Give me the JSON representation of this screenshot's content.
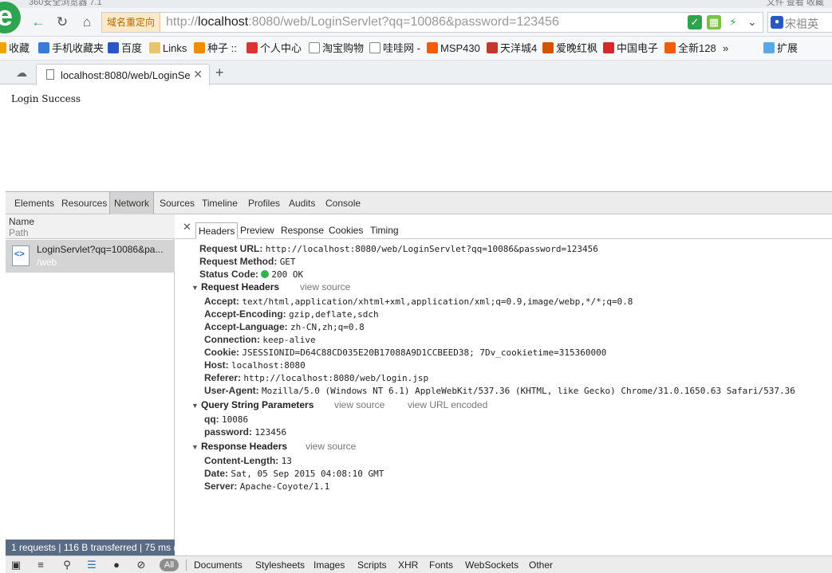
{
  "window": {
    "title": "360安全浏览器 7.1",
    "controls_text": "文件   查看   收藏"
  },
  "navbar": {
    "redirect_label": "域名重定向",
    "url_prefix": "http://",
    "url_host": "localhost",
    "url_rest": ":8080/web/LoginServlet?qq=10086&password=123456",
    "search_placeholder": "宋祖英"
  },
  "bookmarks": [
    {
      "label": "收藏",
      "icon": "star-icon",
      "color": "#f0a400"
    },
    {
      "label": "手机收藏夹",
      "icon": "phone-icon",
      "color": "#3a7bd5"
    },
    {
      "label": "百度",
      "icon": "baidu-icon",
      "color": "#2b57c5"
    },
    {
      "label": "Links",
      "icon": "folder-icon",
      "color": "#e9c46a"
    },
    {
      "label": "种子 ::",
      "icon": "seed-icon",
      "color": "#f08c00"
    },
    {
      "label": "个人中心",
      "icon": "bird-icon",
      "color": "#d33"
    },
    {
      "label": "淘宝购物",
      "icon": "page-icon",
      "color": "#ffffff"
    },
    {
      "label": "哇哇网 -",
      "icon": "page-icon",
      "color": "#ffffff"
    },
    {
      "label": "MSP430",
      "icon": "taobao-icon",
      "color": "#f25c05"
    },
    {
      "label": "天洋城4",
      "icon": "house-icon",
      "color": "#c0392b"
    },
    {
      "label": "爱晚红枫",
      "icon": "leaf-icon",
      "color": "#d35400"
    },
    {
      "label": "中国电子",
      "icon": "site21-icon",
      "color": "#d62828"
    },
    {
      "label": "全新128",
      "icon": "taobao-icon",
      "color": "#f25c05"
    },
    {
      "label": "»",
      "icon": "",
      "color": ""
    },
    {
      "label": "扩展",
      "icon": "extension-icon",
      "color": "#5aa9e6"
    }
  ],
  "tab": {
    "title": "localhost:8080/web/LoginSe"
  },
  "page": {
    "message": "Login Success"
  },
  "devtools": {
    "tabs": [
      "Elements",
      "Resources",
      "Network",
      "Sources",
      "Timeline",
      "Profiles",
      "Audits",
      "Console"
    ],
    "active_tab": "Network",
    "left": {
      "col_name": "Name",
      "col_path": "Path",
      "request_name": "LoginServlet?qq=10086&pa...",
      "request_path": "/web",
      "status": "1 requests | 116 B transferred | 75 ms ("
    },
    "detail_tabs": [
      "Headers",
      "Preview",
      "Response",
      "Cookies",
      "Timing"
    ],
    "active_detail_tab": "Headers",
    "general": [
      {
        "k": "Request URL:",
        "v": "http://localhost:8080/web/LoginServlet?qq=10086&password=123456"
      },
      {
        "k": "Request Method:",
        "v": "GET"
      },
      {
        "k": "Status Code:",
        "v": "200 OK"
      }
    ],
    "request_headers_title": "Request Headers",
    "request_headers": [
      {
        "k": "Accept:",
        "v": "text/html,application/xhtml+xml,application/xml;q=0.9,image/webp,*/*;q=0.8"
      },
      {
        "k": "Accept-Encoding:",
        "v": "gzip,deflate,sdch"
      },
      {
        "k": "Accept-Language:",
        "v": "zh-CN,zh;q=0.8"
      },
      {
        "k": "Connection:",
        "v": "keep-alive"
      },
      {
        "k": "Cookie:",
        "v": "JSESSIONID=D64C88CD035E20B17088A9D1CCBEED38; 7Dv_cookietime=315360000"
      },
      {
        "k": "Host:",
        "v": "localhost:8080"
      },
      {
        "k": "Referer:",
        "v": "http://localhost:8080/web/login.jsp"
      },
      {
        "k": "User-Agent:",
        "v": "Mozilla/5.0 (Windows NT 6.1) AppleWebKit/537.36 (KHTML, like Gecko) Chrome/31.0.1650.63 Safari/537.36"
      }
    ],
    "query_title": "Query String Parameters",
    "query_params": [
      {
        "k": "qq:",
        "v": "10086"
      },
      {
        "k": "password:",
        "v": "123456"
      }
    ],
    "response_headers_title": "Response Headers",
    "response_headers": [
      {
        "k": "Content-Length:",
        "v": "13"
      },
      {
        "k": "Date:",
        "v": "Sat, 05 Sep 2015 04:08:10 GMT"
      },
      {
        "k": "Server:",
        "v": "Apache-Coyote/1.1"
      }
    ],
    "view_source": "view source",
    "view_url_encoded": "view URL encoded",
    "filter_all": "All",
    "filters": [
      "Documents",
      "Stylesheets",
      "Images",
      "Scripts",
      "XHR",
      "Fonts",
      "WebSockets",
      "Other"
    ],
    "status_color": "#2fb34a"
  }
}
